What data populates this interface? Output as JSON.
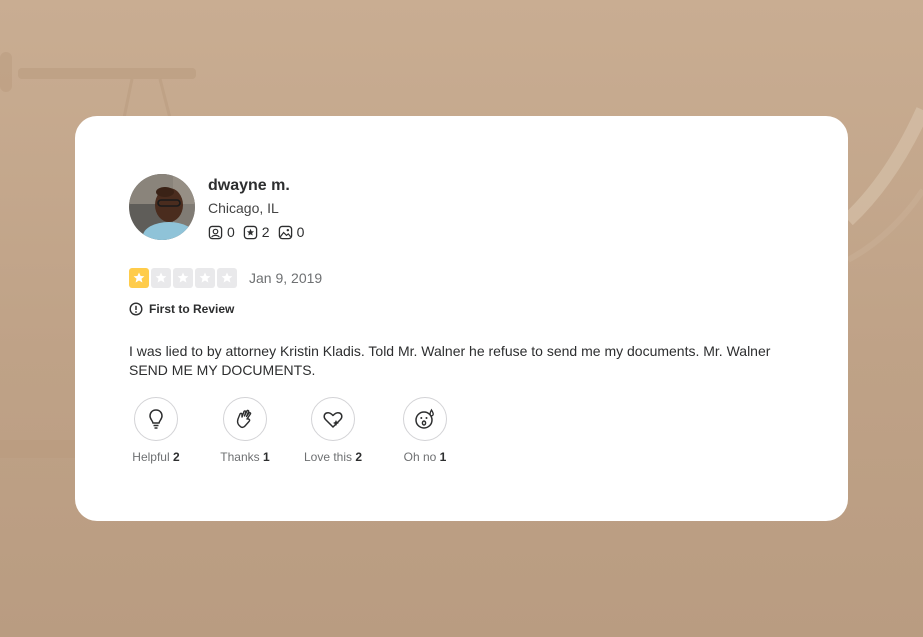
{
  "user": {
    "name": "dwayne m.",
    "location": "Chicago, IL",
    "stats": [
      {
        "icon": "friends-icon",
        "value": "0"
      },
      {
        "icon": "reviews-star-icon",
        "value": "2"
      },
      {
        "icon": "photos-icon",
        "value": "0"
      }
    ]
  },
  "review": {
    "rating": 1,
    "max_rating": 5,
    "date": "Jan 9, 2019",
    "badge": "First to Review",
    "text": "I was lied to by attorney Kristin Kladis. Told Mr. Walner he refuse to send me my documents. Mr. Walner SEND ME MY DOCUMENTS."
  },
  "reactions": [
    {
      "label": "Helpful",
      "count": "2",
      "icon": "lightbulb-icon"
    },
    {
      "label": "Thanks",
      "count": "1",
      "icon": "clapping-hands-icon"
    },
    {
      "label": "Love this",
      "count": "2",
      "icon": "heart-icon"
    },
    {
      "label": "Oh no",
      "count": "1",
      "icon": "surprised-face-icon"
    }
  ],
  "colors": {
    "background": "#c4a88d",
    "card": "#ffffff",
    "star_filled": "#ffcc4b",
    "star_empty": "#e9e9eb",
    "text_primary": "#2d2e2f",
    "text_secondary": "#6e7072"
  }
}
